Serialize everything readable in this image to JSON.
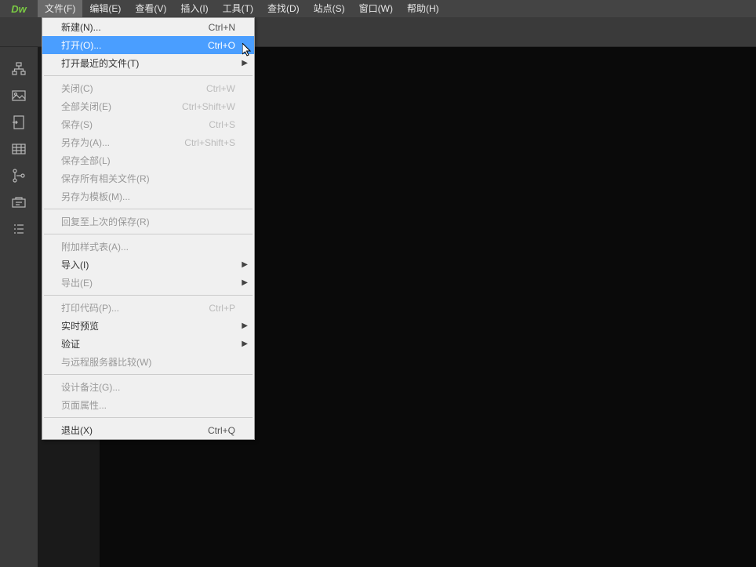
{
  "app": {
    "logo": "Dw"
  },
  "menubar": {
    "items": [
      {
        "label": "文件(F)",
        "active": true
      },
      {
        "label": "编辑(E)"
      },
      {
        "label": "查看(V)"
      },
      {
        "label": "插入(I)"
      },
      {
        "label": "工具(T)"
      },
      {
        "label": "查找(D)"
      },
      {
        "label": "站点(S)"
      },
      {
        "label": "窗口(W)"
      },
      {
        "label": "帮助(H)"
      }
    ]
  },
  "dropdown": {
    "groups": [
      [
        {
          "label": "新建(N)...",
          "shortcut": "Ctrl+N"
        },
        {
          "label": "打开(O)...",
          "shortcut": "Ctrl+O",
          "highlighted": true
        },
        {
          "label": "打开最近的文件(T)",
          "submenu": true
        }
      ],
      [
        {
          "label": "关闭(C)",
          "shortcut": "Ctrl+W",
          "disabled": true
        },
        {
          "label": "全部关闭(E)",
          "shortcut": "Ctrl+Shift+W",
          "disabled": true
        },
        {
          "label": "保存(S)",
          "shortcut": "Ctrl+S",
          "disabled": true
        },
        {
          "label": "另存为(A)...",
          "shortcut": "Ctrl+Shift+S",
          "disabled": true
        },
        {
          "label": "保存全部(L)",
          "disabled": true
        },
        {
          "label": "保存所有相关文件(R)",
          "disabled": true
        },
        {
          "label": "另存为模板(M)...",
          "disabled": true
        }
      ],
      [
        {
          "label": "回复至上次的保存(R)",
          "disabled": true
        }
      ],
      [
        {
          "label": "附加样式表(A)...",
          "disabled": true
        },
        {
          "label": "导入(I)",
          "submenu": true
        },
        {
          "label": "导出(E)",
          "submenu": true,
          "disabled": true
        }
      ],
      [
        {
          "label": "打印代码(P)...",
          "shortcut": "Ctrl+P",
          "disabled": true
        },
        {
          "label": "实时预览",
          "submenu": true
        },
        {
          "label": "验证",
          "submenu": true
        },
        {
          "label": "与远程服务器比较(W)",
          "disabled": true
        }
      ],
      [
        {
          "label": "设计备注(G)...",
          "disabled": true
        },
        {
          "label": "页面属性...",
          "disabled": true
        }
      ],
      [
        {
          "label": "退出(X)",
          "shortcut": "Ctrl+Q"
        }
      ]
    ]
  },
  "sidebar": {
    "icons": [
      "hierarchy-icon",
      "image-icon",
      "insert-icon",
      "grid-icon",
      "tree-icon",
      "settings-icon",
      "list-icon"
    ]
  }
}
